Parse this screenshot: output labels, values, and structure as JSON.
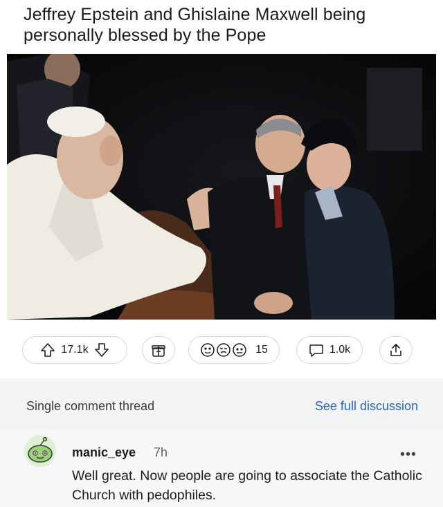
{
  "post": {
    "title": "Jeffrey Epstein and Ghislaine Maxwell being personally blessed by the Pope"
  },
  "actions": {
    "votes": "17.1k",
    "reactions_count": "15",
    "comments": "1.0k",
    "icons": {
      "upvote": "arrow-up-icon",
      "downvote": "arrow-down-icon",
      "award": "gift-icon",
      "reactions": "emoji-reactions-icon",
      "comments": "speech-bubble-icon",
      "share": "share-upload-icon"
    }
  },
  "thread": {
    "label": "Single comment thread",
    "full_link": "See full discussion"
  },
  "comment": {
    "username": "manic_eye",
    "age": "7h",
    "more": "•••",
    "body": "Well great. Now people are going to associate the Catholic Church with pedophiles.",
    "avatar_color": "#9bd07a"
  },
  "colors": {
    "link": "#2a63b8",
    "thread_bg": "#f2f3f5",
    "border": "#d6d9dc"
  }
}
